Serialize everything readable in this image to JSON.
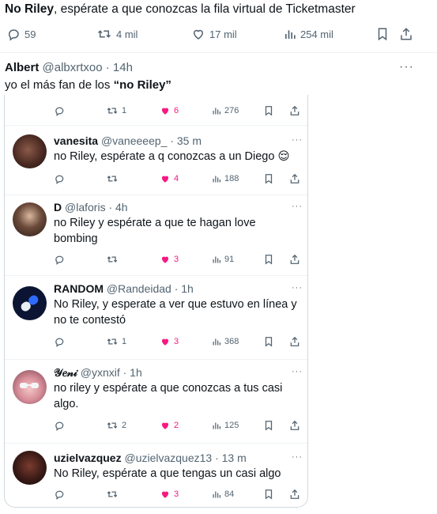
{
  "main_tweet": {
    "name": "No Riley",
    "text": ", espérate a que conozcas la fila virtual de Ticketmaster",
    "replies": "59",
    "retweets": "4 mil",
    "likes": "17 mil",
    "views": "254 mil"
  },
  "quote_tweet": {
    "name": "Albert",
    "handle_time": "@albxrtxoo · 14h",
    "text_prefix": "yo el más fan de los ",
    "text_bold": "“no Riley”",
    "more": "···",
    "card_actions": {
      "retweets": "1",
      "likes": "6",
      "views": "276"
    }
  },
  "replies": [
    {
      "name": "vanesita",
      "handle_time": "@vaneeeep_ · 35 m",
      "text": "no Riley, espérate a q conozcas a un Diego 😌",
      "retweets": "",
      "likes": "4",
      "views": "188",
      "more": "···"
    },
    {
      "name": "D",
      "handle_time": "@laforis · 4h",
      "text": "no Riley y espérate a que te hagan love bombing",
      "retweets": "",
      "likes": "3",
      "views": "91",
      "more": "···"
    },
    {
      "name": "RANDOM",
      "handle_time": "@Randeidad · 1h",
      "text": "No Riley, y esperate a ver que estuvo en línea y no te contestó",
      "retweets": "1",
      "likes": "3",
      "views": "368",
      "more": "···"
    },
    {
      "name": "𝒴𝑒𝓃𝒾",
      "handle_time": "@yxnxif · 1h",
      "text": "no riley y espérate a que conozcas a tus casi algo.",
      "retweets": "2",
      "likes": "2",
      "views": "125",
      "more": "···"
    },
    {
      "name": "uzielvazquez",
      "handle_time": "@uzielvazquez13 · 13 m",
      "text": "No Riley, espérate a que tengas un casi algo",
      "retweets": "",
      "likes": "3",
      "views": "84",
      "more": "···"
    }
  ],
  "colors": {
    "text": "#0f1419",
    "secondary": "#536471",
    "like": "#f91880",
    "border": "#cfd9de"
  }
}
